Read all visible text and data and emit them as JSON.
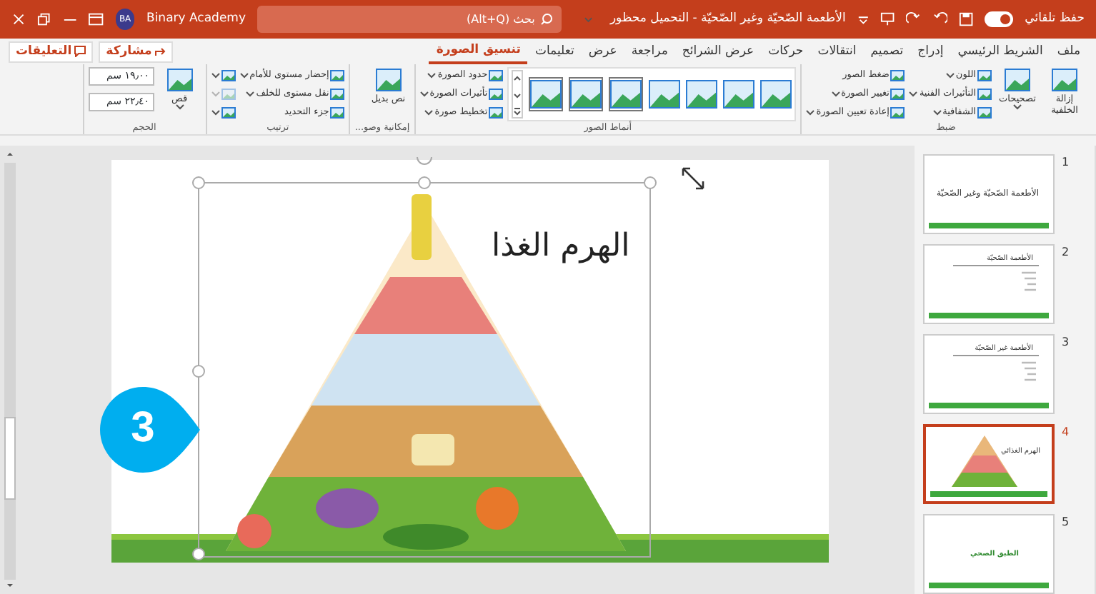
{
  "title_bar": {
    "autosave_label": "حفظ تلقائي",
    "autosave_on": true,
    "document_title": "الأطعمة الصّحيّة وغير الصّحيّة - التحميل محظور",
    "search_placeholder": "بحث (Alt+Q)",
    "user_initials": "BA",
    "user_name": "Binary Academy"
  },
  "tabs": [
    {
      "label": "ملف",
      "selected": false
    },
    {
      "label": "الشريط الرئيسي",
      "selected": false
    },
    {
      "label": "إدراج",
      "selected": false
    },
    {
      "label": "تصميم",
      "selected": false
    },
    {
      "label": "انتقالات",
      "selected": false
    },
    {
      "label": "حركات",
      "selected": false
    },
    {
      "label": "عرض الشرائح",
      "selected": false
    },
    {
      "label": "مراجعة",
      "selected": false
    },
    {
      "label": "عرض",
      "selected": false
    },
    {
      "label": "تعليمات",
      "selected": false
    },
    {
      "label": "تنسيق الصورة",
      "selected": true
    }
  ],
  "share_button": "مشاركة",
  "comments_button": "التعليقات",
  "ribbon": [
    {
      "label": "ضبط",
      "columns": [
        [
          {
            "kind": "large",
            "label": "إزالة الخلفية",
            "dropdown": false
          }
        ],
        [
          {
            "kind": "large",
            "label": "تصحيحات",
            "dropdown": true
          }
        ],
        [
          {
            "kind": "small",
            "label": "اللون",
            "dropdown": true
          },
          {
            "kind": "small",
            "label": "التأثيرات الفنية",
            "dropdown": true
          },
          {
            "kind": "small",
            "label": "الشفافية",
            "dropdown": true
          }
        ],
        [
          {
            "kind": "small",
            "label": "ضغط الصور",
            "dropdown": false
          },
          {
            "kind": "small",
            "label": "تغيير الصورة",
            "dropdown": true
          },
          {
            "kind": "small",
            "label": "إعادة تعيين الصورة",
            "dropdown": true
          }
        ]
      ]
    },
    {
      "label": "أنماط الصور",
      "columns": [
        [
          {
            "kind": "gallery"
          }
        ],
        [
          {
            "kind": "small",
            "label": "حدود الصورة",
            "dropdown": true
          },
          {
            "kind": "small",
            "label": "تأثيرات الصورة",
            "dropdown": true
          },
          {
            "kind": "small",
            "label": "تخطيط صورة",
            "dropdown": true
          }
        ]
      ]
    },
    {
      "label": "إمكانية وصو...",
      "columns": [
        [
          {
            "kind": "large",
            "label": "نص بديل",
            "dropdown": false
          }
        ]
      ]
    },
    {
      "label": "ترتيب",
      "columns": [
        [
          {
            "kind": "small",
            "label": "إحضار مستوى للأمام",
            "dropdown": true
          },
          {
            "kind": "small",
            "label": "نقل مستوى للخلف",
            "dropdown": true
          },
          {
            "kind": "small",
            "label": "جزء التحديد",
            "dropdown": false
          }
        ],
        [
          {
            "kind": "icon",
            "dropdown": true,
            "disabled": false
          },
          {
            "kind": "icon",
            "dropdown": true,
            "disabled": true
          },
          {
            "kind": "icon",
            "dropdown": true,
            "disabled": false
          }
        ]
      ]
    },
    {
      "label": "الحجم",
      "columns": [
        [
          {
            "kind": "large",
            "label": "قص",
            "dropdown": true
          }
        ],
        [
          {
            "kind": "field",
            "value": "١٩٫٠٠ سم"
          },
          {
            "kind": "field",
            "value": "٢٢٫٤٠ سم"
          }
        ]
      ]
    }
  ],
  "slide": {
    "title": "الهرم الغذا",
    "callout": "3"
  },
  "thumbnails": [
    {
      "number": "1",
      "kind": "title",
      "title": "الأطعمة الصّحيّة وغير الصّحيّة",
      "selected": false
    },
    {
      "number": "2",
      "kind": "list",
      "title": "الأطعمة الصّحيّة",
      "selected": false
    },
    {
      "number": "3",
      "kind": "list",
      "title": "الأطعمة غير الصّحيّة",
      "selected": false
    },
    {
      "number": "4",
      "kind": "pyramid",
      "title": "الهرم الغذائي",
      "selected": true
    },
    {
      "number": "5",
      "kind": "section",
      "title": "الطبق الصحي",
      "selected": false
    }
  ]
}
